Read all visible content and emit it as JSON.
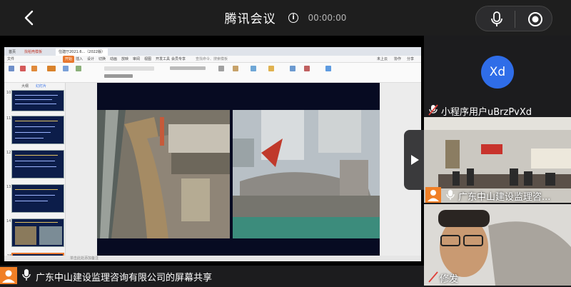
{
  "header": {
    "title": "腾讯会议",
    "info_glyph": "i",
    "timer": "00:00:00"
  },
  "document": {
    "tabs": [
      "首页",
      "找稻壳模板",
      "住建厅2021.6...（2022版）"
    ],
    "menu": [
      "文件",
      "开始",
      "插入",
      "设计",
      "切换",
      "动画",
      "放映",
      "审阅",
      "视图",
      "开发工具",
      "会员专享"
    ],
    "search_hint": "查找命令、搜索模板",
    "right_menu": [
      "未上云",
      "协作",
      "分享"
    ],
    "thumb_tabs": [
      "大纲",
      "幻灯片"
    ],
    "thumb_numbers": [
      "10",
      "11",
      "12",
      "13",
      "14",
      "15"
    ],
    "note_text": "单击此处添加备注"
  },
  "caption": {
    "share_text": "广东中山建设监理咨询有限公司的屏幕共享"
  },
  "participants": [
    {
      "avatar_text": "Xd",
      "name": "小程序用户uBrzPvXd"
    },
    {
      "name": "广东中山建设监理咨..."
    },
    {
      "name": "修发"
    }
  ],
  "colors": {
    "brand_orange": "#f07f26",
    "avatar_blue": "#2f6de8",
    "muted_red": "#e0403a"
  }
}
